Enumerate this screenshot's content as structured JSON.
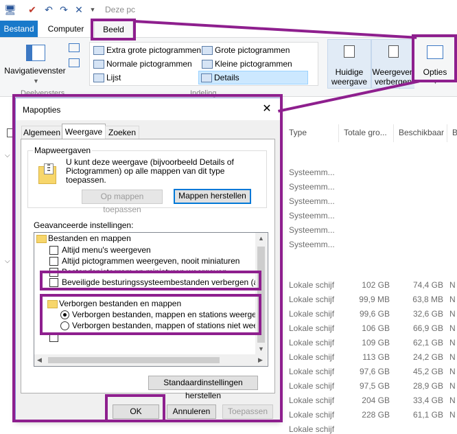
{
  "titlebar": {
    "title": "Deze pc"
  },
  "ribbon_tabs": {
    "bestand": "Bestand",
    "computer": "Computer",
    "beeld": "Beeld"
  },
  "ribbon": {
    "navpane_label": "Navigatievenster",
    "panes_group": "Deelvensters",
    "layout_group": "Indeling",
    "layout_items": [
      "Extra grote pictogrammen",
      "Grote pictogrammen",
      "Normale pictogrammen",
      "Kleine pictogrammen",
      "Lijst",
      "Details"
    ],
    "current_view_line1": "Huidige",
    "current_view_line2": "weergave",
    "show_hide_line1": "Weergeven",
    "show_hide_line2": "verbergen",
    "options_label": "Opties"
  },
  "listing": {
    "columns": {
      "type": "Type",
      "total": "Totale gro...",
      "free": "Beschikbaar",
      "extra": "B"
    },
    "system_rows": [
      "Systeemm...",
      "Systeemm...",
      "Systeemm...",
      "Systeemm...",
      "Systeemm...",
      "Systeemm..."
    ],
    "drive_rows": [
      {
        "type": "Lokale schijf",
        "total": "102 GB",
        "free": "74,4 GB",
        "extra": "N"
      },
      {
        "type": "Lokale schijf",
        "total": "99,9 MB",
        "free": "63,8 MB",
        "extra": "N"
      },
      {
        "type": "Lokale schijf",
        "total": "99,6 GB",
        "free": "32,6 GB",
        "extra": "N"
      },
      {
        "type": "Lokale schijf",
        "total": "106 GB",
        "free": "66,9 GB",
        "extra": "N"
      },
      {
        "type": "Lokale schijf",
        "total": "109 GB",
        "free": "62,1 GB",
        "extra": "N"
      },
      {
        "type": "Lokale schijf",
        "total": "113 GB",
        "free": "24,2 GB",
        "extra": "N"
      },
      {
        "type": "Lokale schijf",
        "total": "97,6 GB",
        "free": "45,2 GB",
        "extra": "N"
      },
      {
        "type": "Lokale schijf",
        "total": "97,5 GB",
        "free": "28,9 GB",
        "extra": "N"
      },
      {
        "type": "Lokale schijf",
        "total": "204 GB",
        "free": "33,4 GB",
        "extra": "N"
      },
      {
        "type": "Lokale schijf",
        "total": "228 GB",
        "free": "61,1 GB",
        "extra": "N"
      },
      {
        "type": "Lokale schijf",
        "total": "",
        "free": "",
        "extra": ""
      }
    ]
  },
  "dialog": {
    "title": "Mapopties",
    "tabs": [
      "Algemeen",
      "Weergave",
      "Zoeken"
    ],
    "mapview_label": "Mapweergaven",
    "mapview_desc": "U kunt deze weergave (bijvoorbeeld Details of Pictogrammen) op alle mappen van dit type toepassen.",
    "apply_button": "Op mappen toepassen",
    "reset_button": "Mappen herstellen",
    "advanced_label": "Geavanceerde instellingen:",
    "tree": {
      "files_folders": "Bestanden en mappen",
      "opt1": "Altijd menu's weergeven",
      "opt2": "Altijd pictogrammen weergeven, nooit miniaturen",
      "opt3": "Bestandspictogram op miniaturen weergeven",
      "opt4": "Beveiligde besturingssysteembestanden verbergen (aanb",
      "hidden_folder": "Verborgen bestanden en mappen",
      "radio1": "Verborgen bestanden, mappen en stations weergeve",
      "radio2": "Verborgen bestanden, mappen of stations niet weerg"
    },
    "defaults_button": "Standaardinstellingen herstellen",
    "ok_button": "OK",
    "cancel_button": "Annuleren",
    "apply_disabled_button": "Toepassen"
  },
  "colors": {
    "accent": "#1979ca",
    "highlight": "#8e1f8e"
  }
}
